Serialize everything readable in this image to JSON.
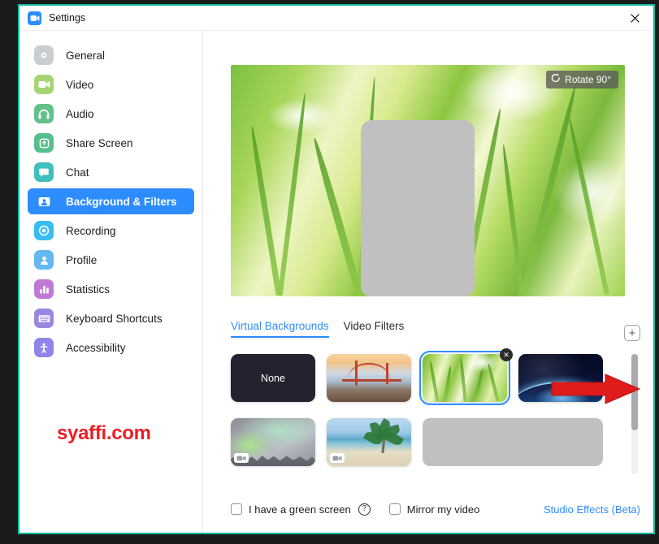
{
  "window": {
    "title": "Settings",
    "logo_icon": "zoom-camera-icon",
    "close_icon": "close-icon",
    "border_color": "#0fbba0",
    "accent_color": "#2d8cff"
  },
  "sidebar": {
    "items": [
      {
        "label": "General",
        "icon": "gear-icon",
        "color": "#c9cdd2",
        "active": false
      },
      {
        "label": "Video",
        "icon": "video-camera-icon",
        "color": "#a6d474",
        "active": false
      },
      {
        "label": "Audio",
        "icon": "headphones-icon",
        "color": "#62c18a",
        "active": false
      },
      {
        "label": "Share Screen",
        "icon": "upload-screen-icon",
        "color": "#55bf8f",
        "active": false
      },
      {
        "label": "Chat",
        "icon": "chat-bubble-icon",
        "color": "#3fc0bc",
        "active": false
      },
      {
        "label": "Background & Filters",
        "icon": "person-frame-icon",
        "color": "#2d8cff",
        "active": true
      },
      {
        "label": "Recording",
        "icon": "record-circle-icon",
        "color": "#39bdf3",
        "active": false
      },
      {
        "label": "Profile",
        "icon": "person-icon",
        "color": "#63b8f0",
        "active": false
      },
      {
        "label": "Statistics",
        "icon": "bar-chart-icon",
        "color": "#c07ad6",
        "active": false
      },
      {
        "label": "Keyboard Shortcuts",
        "icon": "keyboard-icon",
        "color": "#9b87e0",
        "active": false
      },
      {
        "label": "Accessibility",
        "icon": "accessibility-icon",
        "color": "#8f85e8",
        "active": false
      }
    ],
    "watermark": "syaffi.com",
    "watermark_color": "#ed1c24"
  },
  "preview": {
    "rotate_button_label": "Rotate 90°",
    "rotate_icon": "rotate-ccw-icon",
    "redaction_present": true
  },
  "tabs": [
    {
      "label": "Virtual Backgrounds",
      "active": true
    },
    {
      "label": "Video Filters",
      "active": false
    }
  ],
  "add_background": {
    "icon": "plus-icon",
    "label": "+"
  },
  "backgrounds": [
    {
      "name": "None",
      "kind": "none",
      "label": "None",
      "selected": false,
      "video": false,
      "removable": false
    },
    {
      "name": "Golden Gate Bridge",
      "kind": "bridge",
      "label": "",
      "selected": false,
      "video": false,
      "removable": false
    },
    {
      "name": "Grass",
      "kind": "grass",
      "label": "",
      "selected": true,
      "video": false,
      "removable": true,
      "remove_icon": "close-circle-icon"
    },
    {
      "name": "Earth from Space",
      "kind": "space",
      "label": "",
      "selected": false,
      "video": false,
      "removable": false
    },
    {
      "name": "Aurora",
      "kind": "aurora",
      "label": "",
      "selected": false,
      "video": true,
      "removable": false,
      "video_icon": "video-camera-icon"
    },
    {
      "name": "Beach",
      "kind": "beach",
      "label": "",
      "selected": false,
      "video": true,
      "removable": false,
      "video_icon": "video-camera-icon"
    },
    {
      "name": "Redacted",
      "kind": "redacted",
      "label": "",
      "selected": false,
      "video": false,
      "removable": false
    }
  ],
  "annotation": {
    "type": "red-arrow",
    "color": "#e01b1b",
    "points_to": "Grass"
  },
  "bottom_bar": {
    "green_screen_label": "I have a green screen",
    "green_screen_checked": false,
    "help_icon": "question-mark-icon",
    "help_label": "?",
    "mirror_label": "Mirror my video",
    "mirror_checked": false,
    "studio_effects_label": "Studio Effects (Beta)"
  },
  "scrollbar": {
    "name": "thumbnail-scrollbar"
  }
}
